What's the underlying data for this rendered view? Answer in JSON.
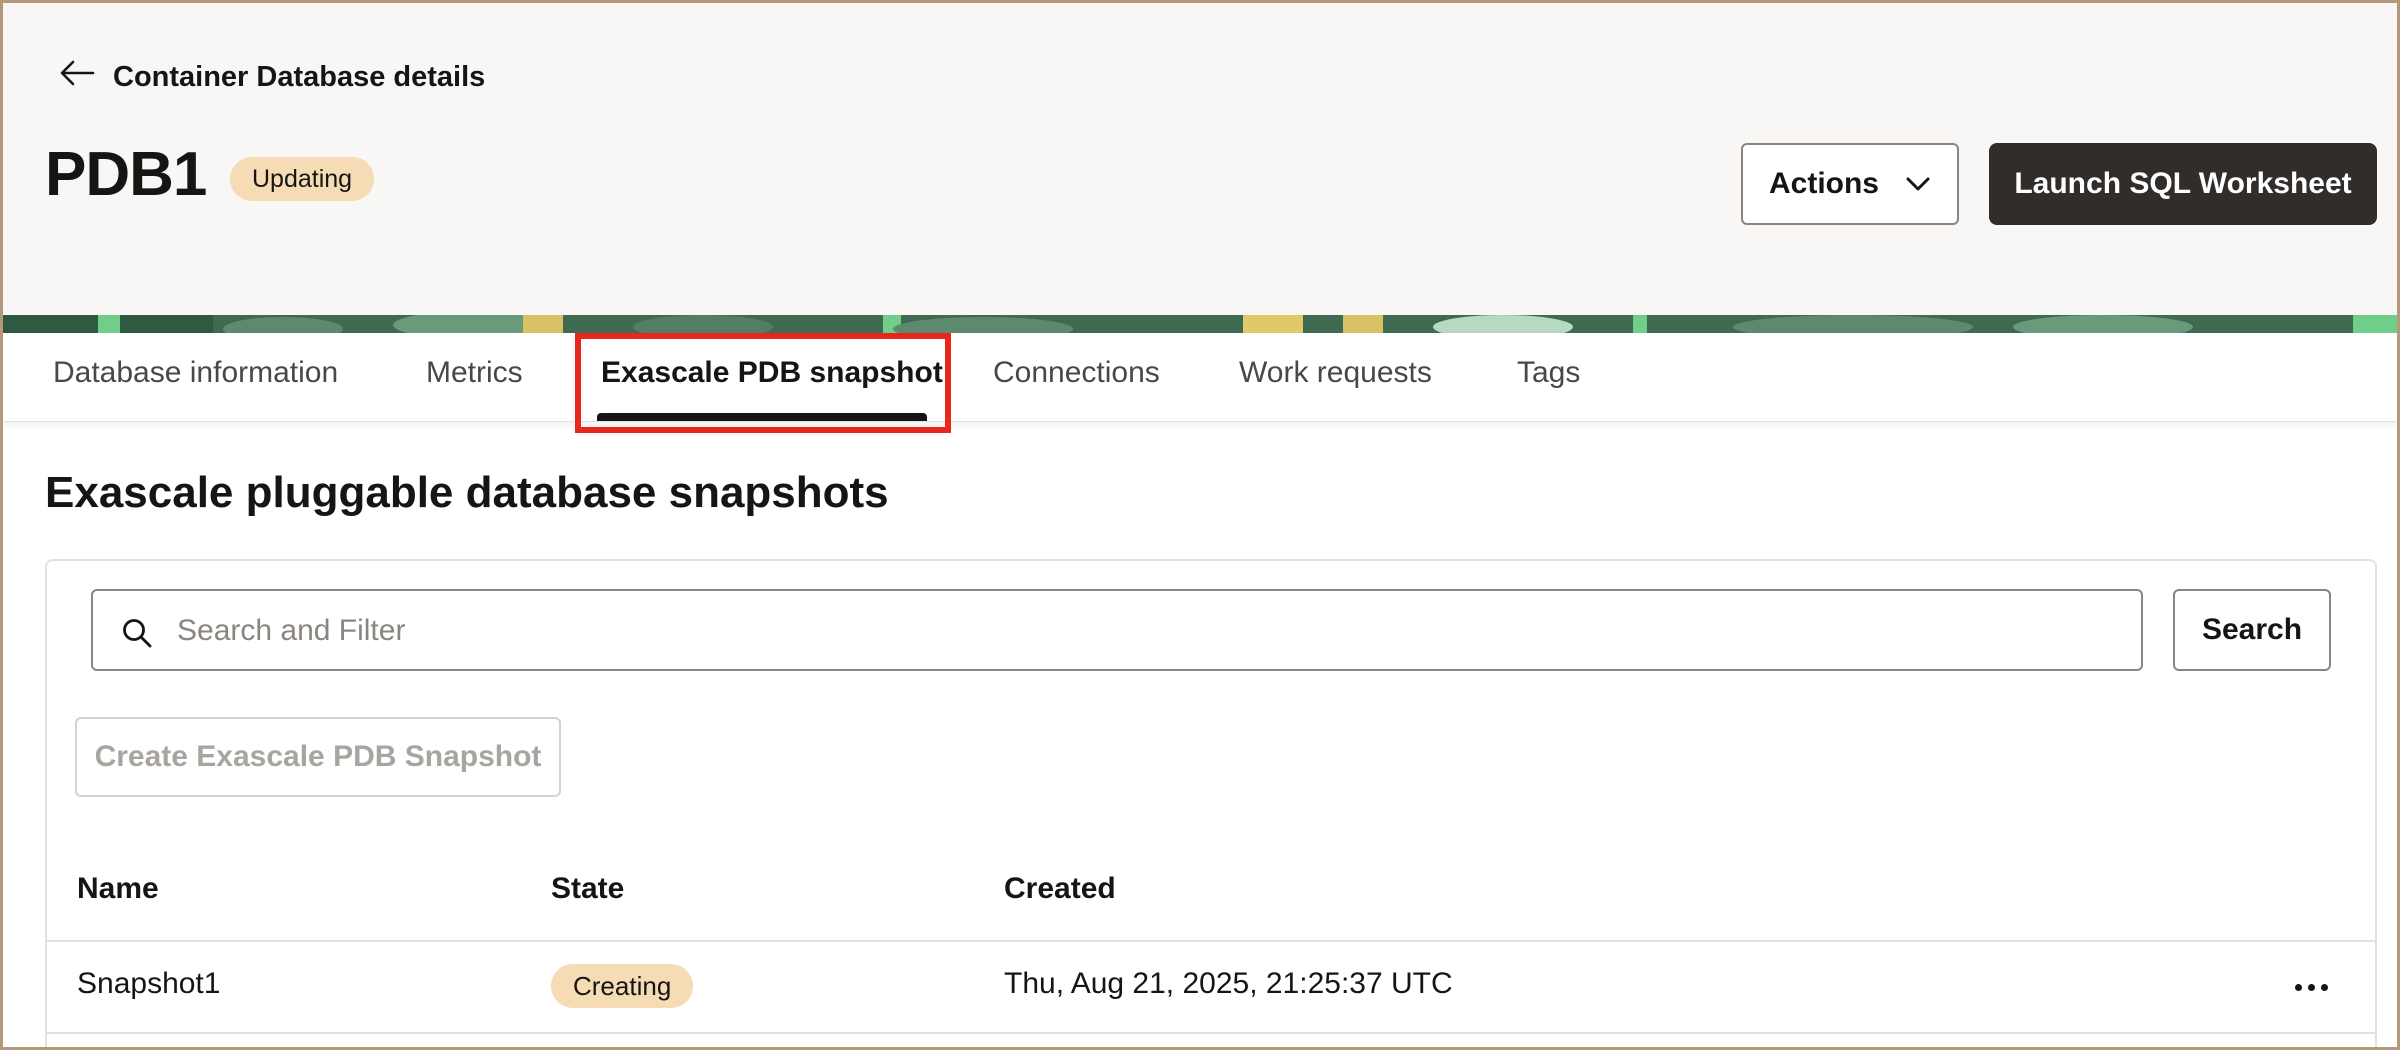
{
  "header": {
    "back_label": "Container Database details",
    "title": "PDB1",
    "status": "Updating",
    "actions_label": "Actions",
    "launch_label": "Launch SQL Worksheet"
  },
  "tabs": [
    {
      "label": "Database information",
      "active": false
    },
    {
      "label": "Metrics",
      "active": false
    },
    {
      "label": "Exascale PDB snapshot",
      "active": true
    },
    {
      "label": "Connections",
      "active": false
    },
    {
      "label": "Work requests",
      "active": false
    },
    {
      "label": "Tags",
      "active": false
    }
  ],
  "section": {
    "title": "Exascale pluggable database snapshots",
    "search_placeholder": "Search and Filter",
    "search_value": "",
    "search_button": "Search",
    "create_button": "Create Exascale PDB Snapshot"
  },
  "table": {
    "columns": [
      "Name",
      "State",
      "Created"
    ],
    "rows": [
      {
        "name": "Snapshot1",
        "state": "Creating",
        "created": "Thu, Aug 21, 2025, 21:25:37 UTC"
      }
    ]
  },
  "colors": {
    "accent_dark": "#312d2a",
    "badge": "#f5dcb4",
    "highlight": "#e8261c",
    "header_bg": "#f9f7f5"
  },
  "icons": [
    "arrow-left-icon",
    "chevron-down-icon",
    "search-icon",
    "more-horizontal-icon"
  ]
}
